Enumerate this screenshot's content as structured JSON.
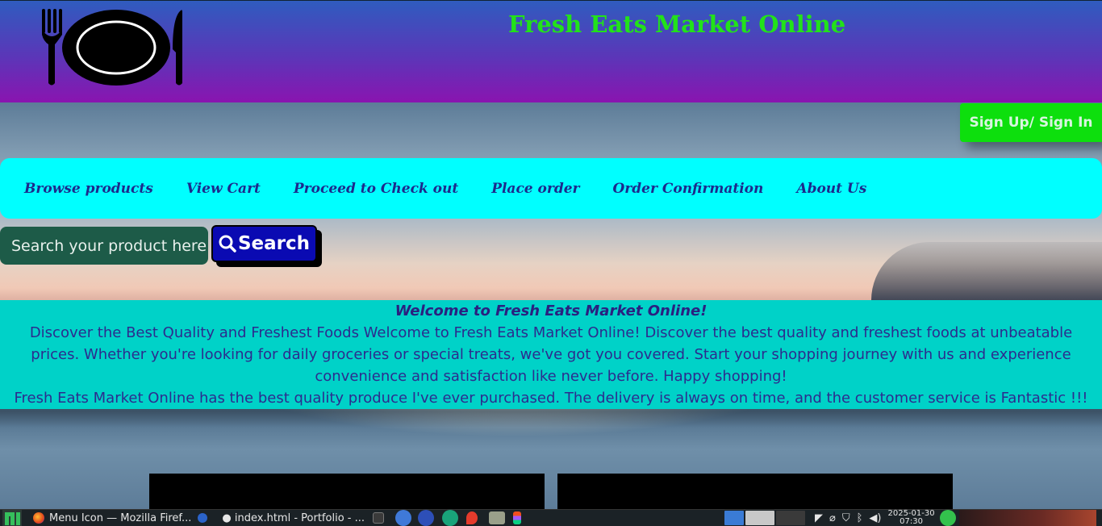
{
  "header": {
    "title": "Fresh Eats Market Online",
    "logo_icon": "plate-fork-knife-icon"
  },
  "auth": {
    "signin_label": "Sign Up/ Sign In"
  },
  "nav": {
    "items": [
      {
        "label": "Browse products"
      },
      {
        "label": "View Cart"
      },
      {
        "label": "Proceed to Check out"
      },
      {
        "label": "Place order"
      },
      {
        "label": "Order Confirmation"
      },
      {
        "label": "About Us"
      }
    ]
  },
  "search": {
    "placeholder": "Search your product here",
    "button_label": "Search",
    "icon": "search-icon"
  },
  "welcome": {
    "heading": "Welcome to Fresh Eats Market Online!",
    "body": "Discover the Best Quality and Freshest Foods Welcome to Fresh Eats Market Online! Discover the best quality and freshest foods at unbeatable prices. Whether you're looking for daily groceries or special treats, we've got you covered. Start your shopping journey with us and experience convenience and satisfaction like never before. Happy shopping!",
    "testimonial": "Fresh Eats Market Online has the best quality produce I've ever purchased. The delivery is always on time, and the customer service is Fantastic !!!"
  },
  "taskbar": {
    "window1": "Menu Icon — Mozilla Firef...",
    "window2": "● index.html - Portfolio - ...",
    "date": "2025-01-30",
    "time": "07:30"
  },
  "colors": {
    "title_green": "#22e21a",
    "nav_bg": "#00ffff",
    "nav_text": "#1c2a8c",
    "signin_bg": "#0ddf0d",
    "search_btn_bg": "#0a0ab2",
    "welcome_bg": "#00d2c8"
  }
}
